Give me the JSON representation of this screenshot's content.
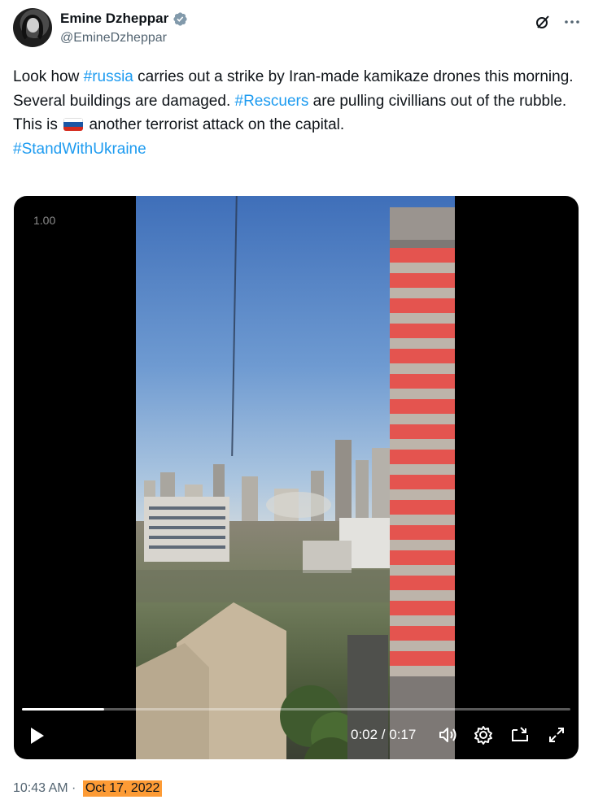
{
  "author": {
    "display_name": "Emine Dzheppar",
    "handle": "@EmineDzheppar",
    "avatar_icon": "profile-photo",
    "verified_icon": "verified-badge-icon",
    "verified_color": "#829aab"
  },
  "header_actions": [
    {
      "name": "grok-icon"
    },
    {
      "name": "more-icon",
      "label": "···"
    }
  ],
  "tweet": {
    "line1_a": "Look how ",
    "tag_russia": "#russia",
    "line1_b": " carries out a strike by Iran-made kamikaze drones this morning. Several buildings are damaged. ",
    "tag_rescuers": "#Rescuers",
    "line1_c": " are pulling civillians out of the rubble.",
    "line2_a": "This is ",
    "flag_icon": "russia-flag-emoji",
    "line2_b": " another terrorist attack on the capital.",
    "tag_stand": "#StandWithUkraine"
  },
  "video": {
    "speed_label": "1.00",
    "time_label": "0:02 / 0:17",
    "progress_fraction": 0.15,
    "controls": [
      "play-icon",
      "volume-icon",
      "settings-icon",
      "pip-icon",
      "fullscreen-icon"
    ]
  },
  "footer": {
    "time": "10:43 AM · ",
    "date": "Oct 17, 2022"
  },
  "colors": {
    "link": "#1d9bf0",
    "secondary_text": "#536471",
    "date_highlight": "#fd9b35"
  }
}
